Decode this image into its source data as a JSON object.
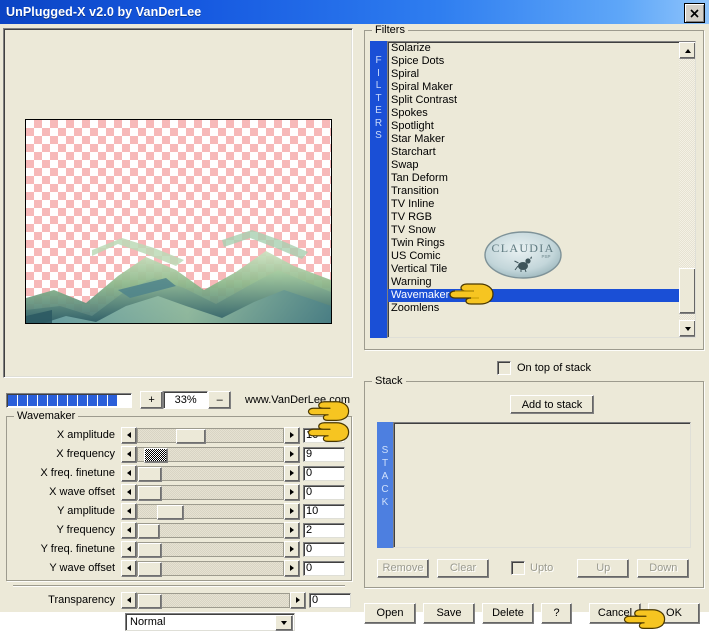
{
  "window": {
    "title": "UnPlugged-X v2.0 by VanDerLee",
    "close_label": "✕"
  },
  "preview": {
    "zoom_value": "33%",
    "zoom_in_label": "+",
    "zoom_out_label": "–",
    "website": "www.VanDerLee.com",
    "progress_blocks": 11
  },
  "filters": {
    "group_title": "Filters",
    "vertical_label": "FILTERS",
    "selected": "Wavemaker",
    "items": [
      "Solarize",
      "Spice Dots",
      "Spiral",
      "Spiral Maker",
      "Split Contrast",
      "Spokes",
      "Spotlight",
      "Star Maker",
      "Starchart",
      "Swap",
      "Tan Deform",
      "Transition",
      "TV Inline",
      "TV RGB",
      "TV Snow",
      "Twin Rings",
      "US Comic",
      "Vertical Tile",
      "Warning",
      "Wavemaker",
      "Zoomlens"
    ],
    "on_top_of_stack_label": "On top of stack",
    "on_top_of_stack_checked": false,
    "watermark_text": "CLAUDIA"
  },
  "wavemaker": {
    "group_title": "Wavemaker",
    "params": [
      {
        "label": "X amplitude",
        "value": "16",
        "thumb_pct": 26,
        "thumb_w": 28,
        "style": "plain"
      },
      {
        "label": "X frequency",
        "value": "9",
        "thumb_pct": 4,
        "thumb_w": 22,
        "style": "checker"
      },
      {
        "label": "X freq. finetune",
        "value": "0",
        "thumb_pct": 0,
        "thumb_w": 22,
        "style": "plain"
      },
      {
        "label": "X wave offset",
        "value": "0",
        "thumb_pct": 0,
        "thumb_w": 22,
        "style": "plain"
      },
      {
        "label": "Y amplitude",
        "value": "10",
        "thumb_pct": 13,
        "thumb_w": 25,
        "style": "plain"
      },
      {
        "label": "Y frequency",
        "value": "2",
        "thumb_pct": 0,
        "thumb_w": 20,
        "style": "plain"
      },
      {
        "label": "Y freq. finetune",
        "value": "0",
        "thumb_pct": 0,
        "thumb_w": 22,
        "style": "plain"
      },
      {
        "label": "Y wave offset",
        "value": "0",
        "thumb_pct": 0,
        "thumb_w": 22,
        "style": "plain"
      }
    ],
    "transparency_label": "Transparency",
    "transparency_value": "0",
    "blend_mode": "Normal"
  },
  "stack": {
    "group_title": "Stack",
    "vertical_label": "STACK",
    "add_to_stack_label": "Add to stack",
    "items": [],
    "remove_label": "Remove",
    "clear_label": "Clear",
    "upto_label": "Upto",
    "upto_checked": false,
    "up_label": "Up",
    "down_label": "Down"
  },
  "bottom_buttons": {
    "open": "Open",
    "save": "Save",
    "delete": "Delete",
    "help": "?",
    "cancel": "Cancel",
    "ok": "OK"
  },
  "colors": {
    "titlebar_blue": "#1659e0",
    "selection_blue": "#1a4fd6",
    "face": "#ece9d8",
    "progress_blue": "#2b5fd9",
    "checker_pink": "#f7b9b9"
  }
}
